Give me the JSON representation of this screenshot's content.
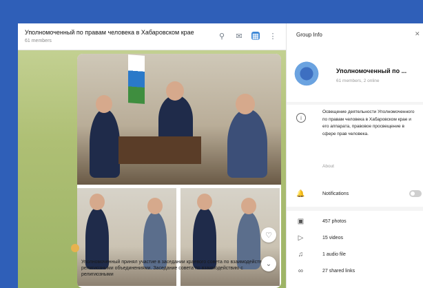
{
  "chat": {
    "title": "Уполномоченный по правам человека в Хабаровском крае",
    "members": "61 members",
    "caption": "Уполномоченный принял участие в заседании краевого совета по взаимодействию с религиозными объединениями. Заседание совета по взаимодействию с религиозными"
  },
  "panel": {
    "title": "Group Info",
    "group_name": "Уполномоченный по ...",
    "group_members": "61 members, 2 online",
    "about_text": "Освещение деятельности Уполномоченного по правам человека в Хабаровском крае и его аппарата, правовое просвещение в сфере прав человека.",
    "about_label": "About",
    "notifications_label": "Notifications",
    "media": [
      {
        "icon": "photo-icon",
        "label": "457 photos"
      },
      {
        "icon": "video-icon",
        "label": "15 videos"
      },
      {
        "icon": "audio-icon",
        "label": "1 audio file"
      },
      {
        "icon": "link-icon",
        "label": "27 shared links"
      }
    ]
  },
  "colors": {
    "frame": "#2f5fb8",
    "accent": "#3a86d6",
    "chat_bg": "#aebf74"
  }
}
